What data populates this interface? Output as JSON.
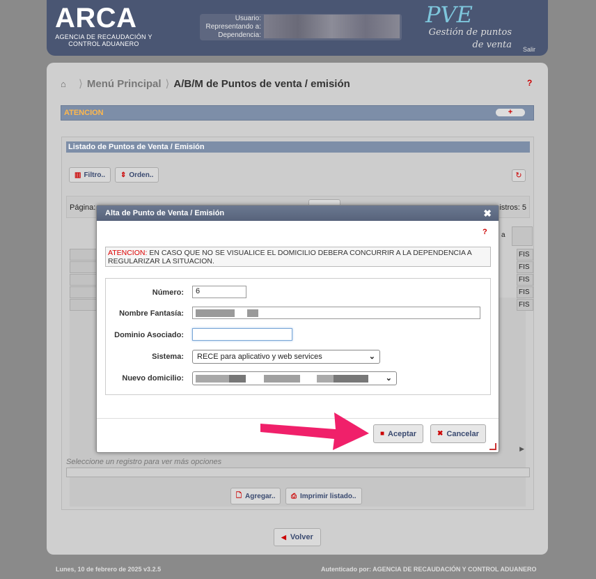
{
  "header": {
    "logo": "ARCA",
    "logo_sub": "AGENCIA DE RECAUDACIÓN Y CONTROL ADUANERO",
    "usuario_label": "Usuario:",
    "representando_label": "Representando a:",
    "dependencia_label": "Dependencia:",
    "app_logo": "PVE",
    "app_sub": "Gestión de puntos de venta",
    "salir": "Salir"
  },
  "breadcrumb": {
    "item1": "Menú Principal",
    "item2": "A/B/M de Puntos de venta / emisión",
    "help": "?"
  },
  "atencion": {
    "label": "ATENCION",
    "toggle": "+"
  },
  "listado": {
    "title": "Listado de Puntos de Venta / Emisión",
    "filtro": "Filtro..",
    "orden": "Orden..",
    "pagina_label": "Página:",
    "registros_label": "istros: 5",
    "col_header": "a",
    "row_values": [
      "FIS",
      "FIS",
      "FIS",
      "FIS",
      "FIS"
    ],
    "hint": "Seleccione un registro para ver más opciones",
    "agregar": "Agregar..",
    "imprimir": "Imprimir listado.."
  },
  "volver": "Volver",
  "footer": {
    "date": "Lunes, 10 de febrero de 2025 v3.2.5",
    "auth": "Autenticado por: AGENCIA DE RECAUDACIÓN Y CONTROL ADUANERO"
  },
  "modal": {
    "title": "Alta de Punto de Venta / Emisión",
    "close": "✖",
    "help": "?",
    "warn_prefix": "ATENCION:",
    "warn_text": " EN CASO QUE NO SE VISUALICE EL DOMICILIO DEBERA CONCURRIR A LA DEPENDENCIA A REGULARIZAR LA SITUACION.",
    "numero_label": "Número:",
    "numero_value": "6",
    "nombre_label": "Nombre Fantasía:",
    "dominio_label": "Dominio Asociado:",
    "dominio_value": "",
    "sistema_label": "Sistema:",
    "sistema_value": "RECE para aplicativo y web services",
    "domicilio_label": "Nuevo domicilio:",
    "aceptar": "Aceptar",
    "cancelar": "Cancelar"
  },
  "colors": {
    "accent": "#7d8ea8",
    "header": "#4a5673",
    "arrow": "#f0206a",
    "danger": "#cc0000"
  }
}
